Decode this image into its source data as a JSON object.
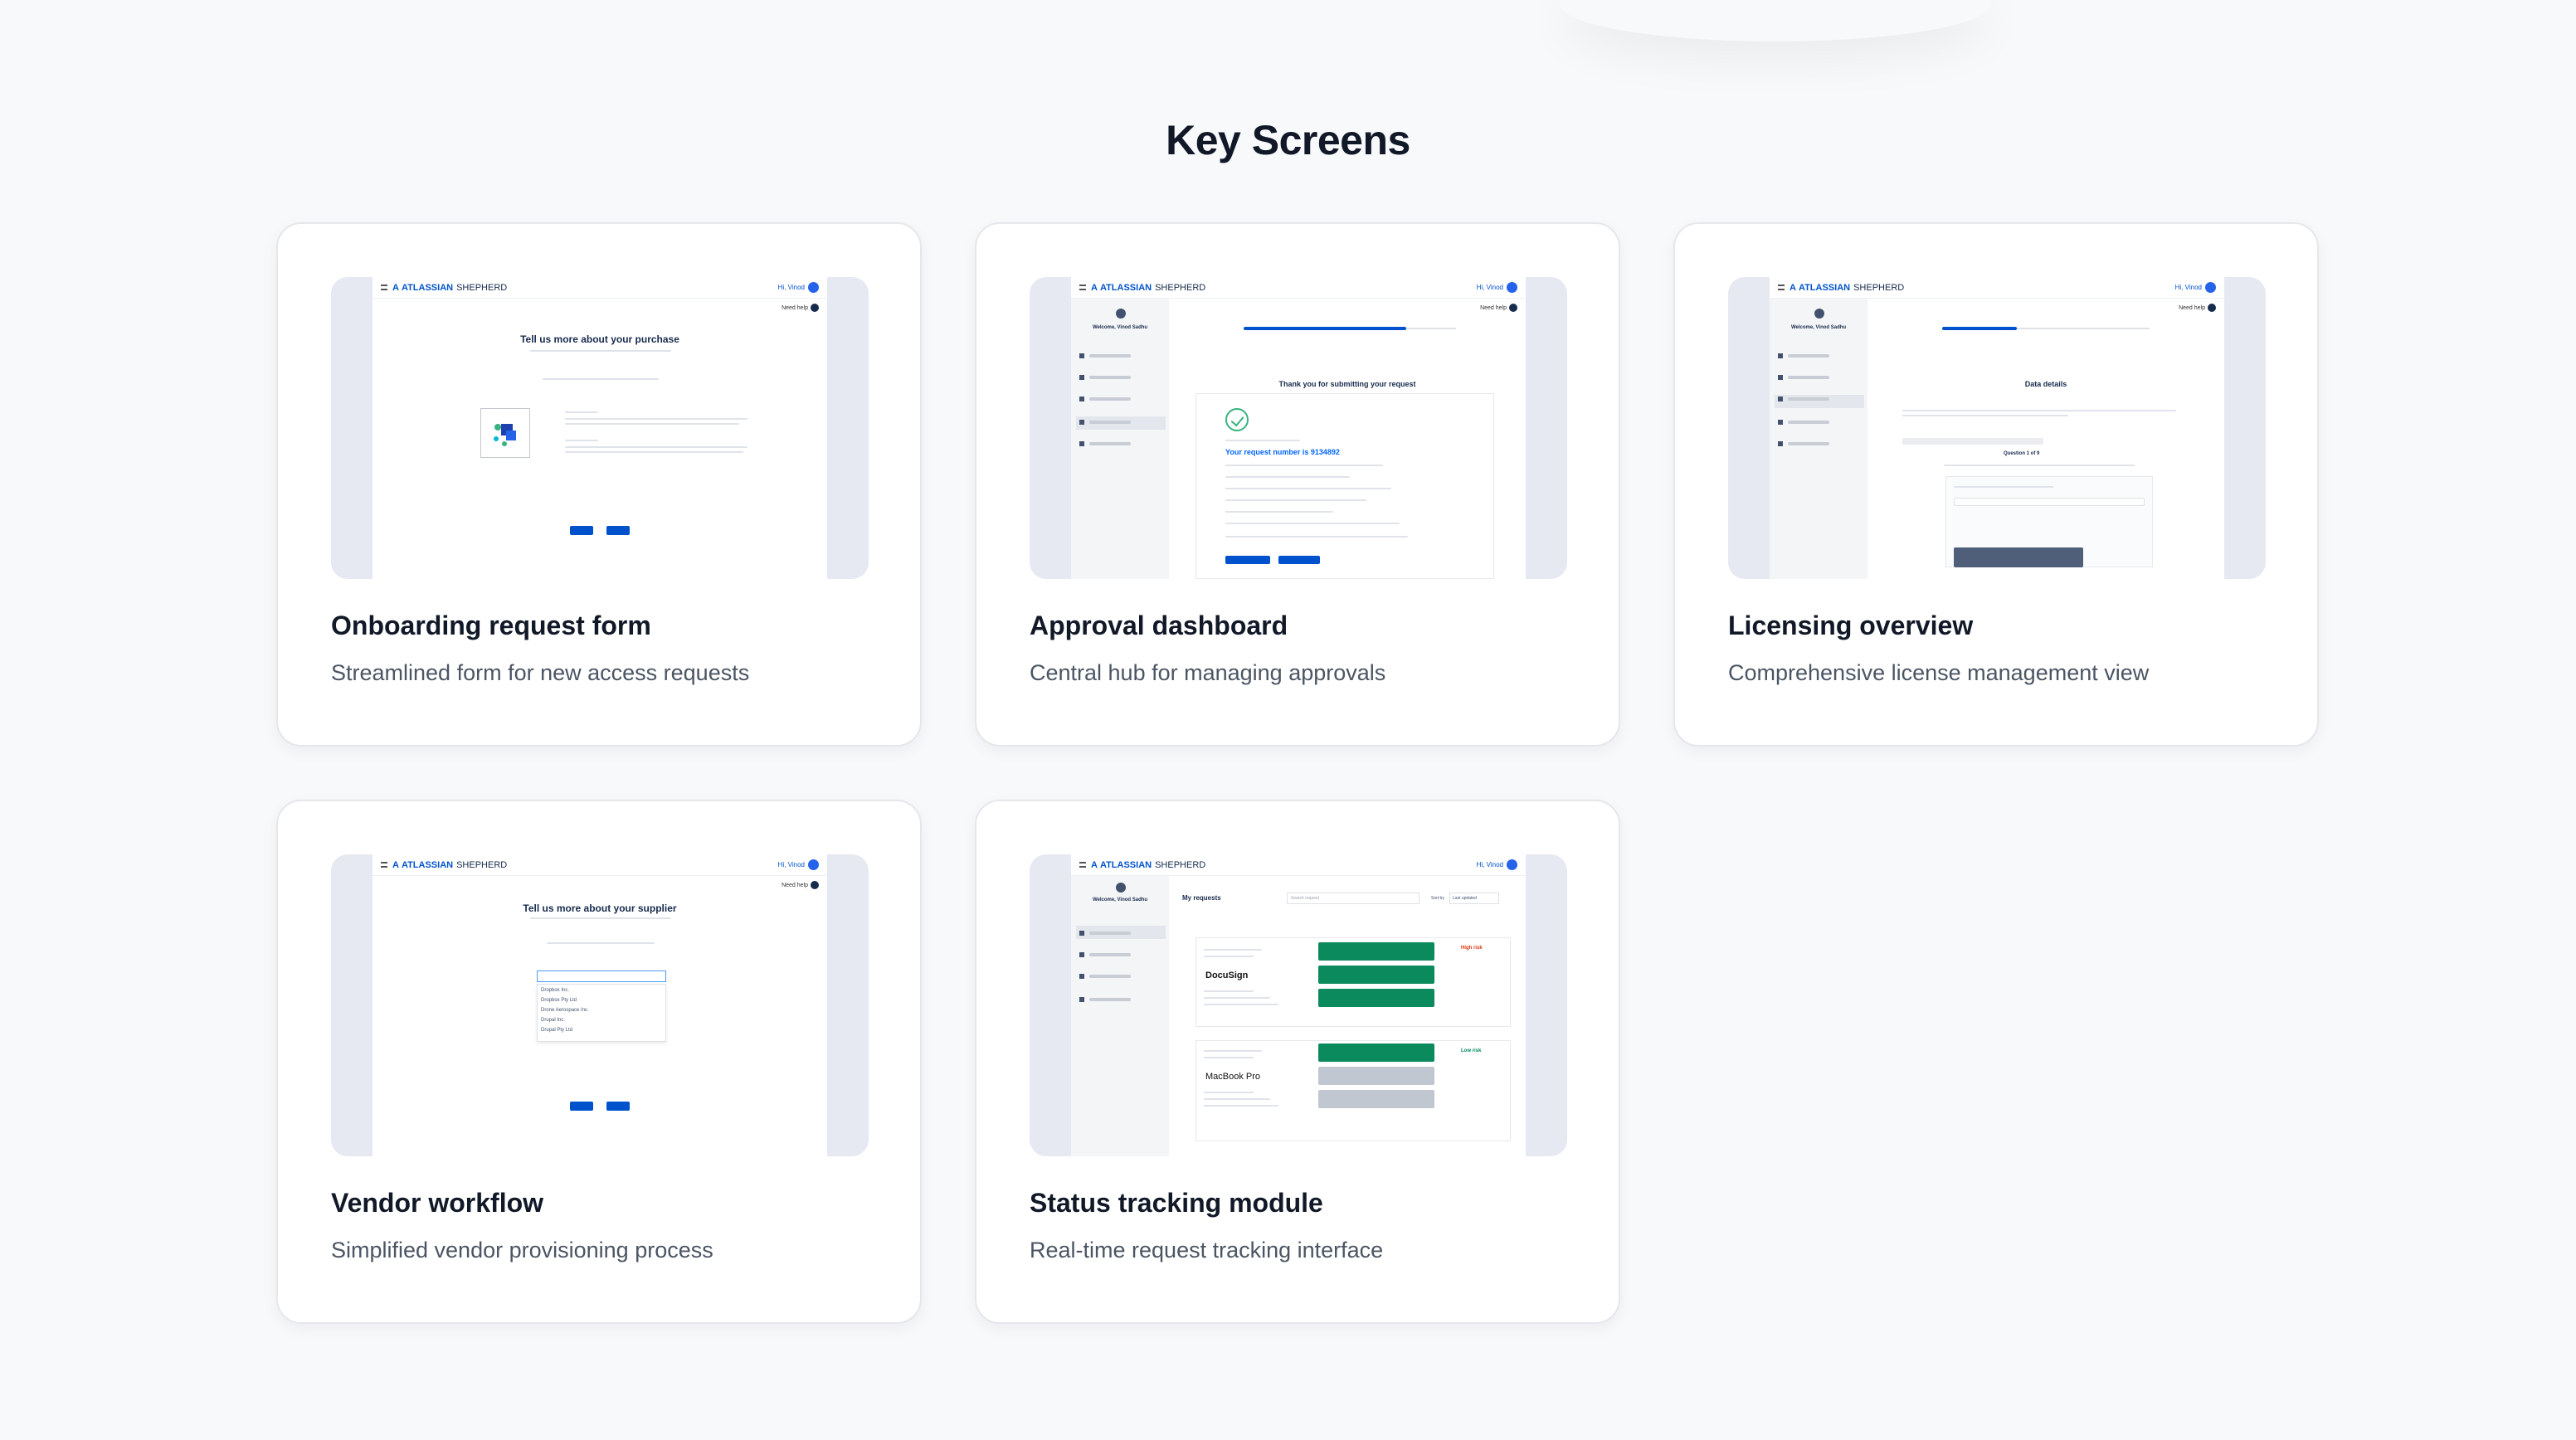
{
  "section": {
    "title": "Key Screens"
  },
  "mini": {
    "logo_mark": "A",
    "brand": "ATLASSIAN",
    "brand2": "SHEPHERD",
    "greeting": "Hi, Vinod",
    "help": "Need help",
    "welcome": "Welcome, Vinod Sadhu"
  },
  "cards": [
    {
      "title": "Onboarding request form",
      "description": "Streamlined form for new access requests",
      "screen_heading": "Tell us more about your purchase"
    },
    {
      "title": "Approval dashboard",
      "description": "Central hub for managing approvals",
      "screen_heading": "Thank you for submitting your request",
      "request_number": "Your request number is 9134892"
    },
    {
      "title": "Licensing overview",
      "description": "Comprehensive license management view",
      "screen_heading": "Data details",
      "question": "Question 1 of 9"
    },
    {
      "title": "Vendor workflow",
      "description": "Simplified vendor provisioning process",
      "screen_heading": "Tell us more about your supplier",
      "options": [
        "Dropbox Inc.",
        "Dropbox Pty Ltd",
        "Drone Aerospace Inc.",
        "Drupal Inc.",
        "Drupal Pty Ltd"
      ]
    },
    {
      "title": "Status tracking module",
      "description": "Real-time request tracking interface",
      "screen_heading": "My requests",
      "search_placeholder": "Search request",
      "sort_label": "Sort by",
      "sort_value": "Last updated",
      "brand_a": "DocuSign",
      "brand_b": "MacBook Pro",
      "risk_high": "High risk",
      "risk_low": "Low risk"
    }
  ]
}
